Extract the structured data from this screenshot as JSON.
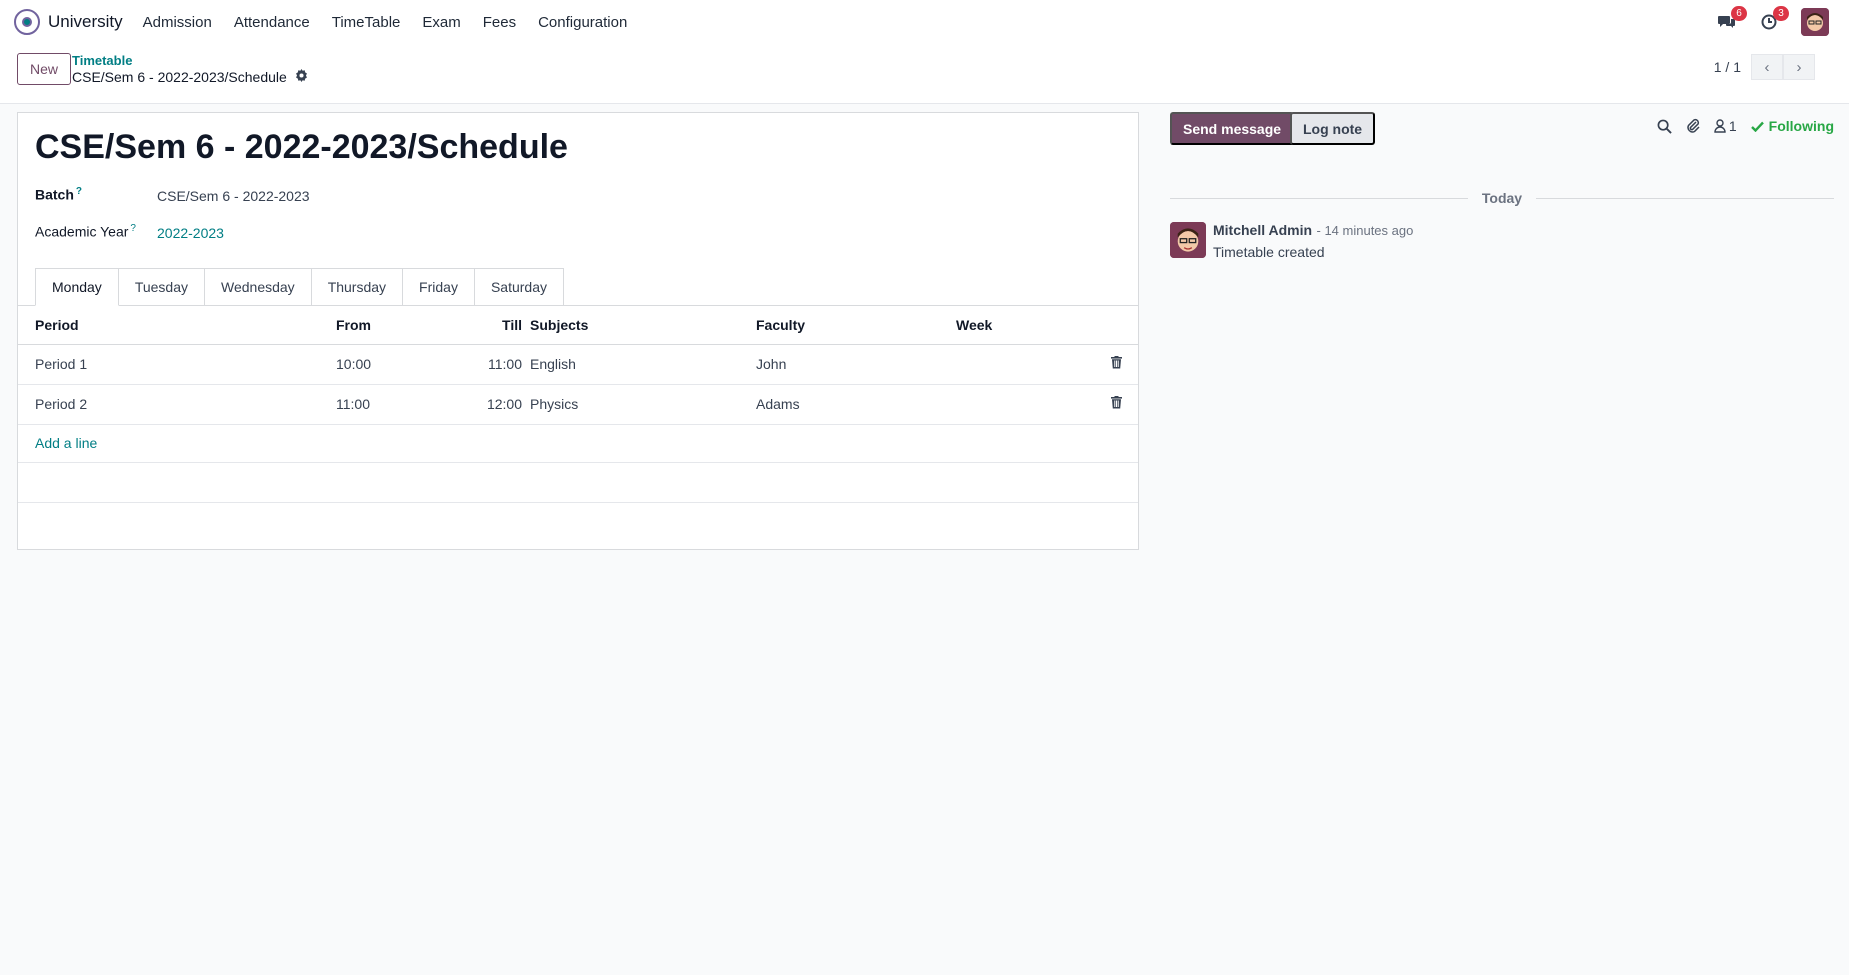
{
  "navbar": {
    "app_name": "University",
    "menu": [
      "Admission",
      "Attendance",
      "TimeTable",
      "Exam",
      "Fees",
      "Configuration"
    ],
    "messages_badge": "6",
    "activity_badge": "3"
  },
  "control_panel": {
    "new_label": "New",
    "breadcrumb_parent": "Timetable",
    "breadcrumb_current": "CSE/Sem 6 - 2022-2023/Schedule",
    "pager_value": "1 / 1"
  },
  "form": {
    "title": "CSE/Sem 6 - 2022-2023/Schedule",
    "batch_label": "Batch",
    "batch_value": "CSE/Sem 6 - 2022-2023",
    "academic_year_label": "Academic Year",
    "academic_year_value": "2022-2023",
    "help_mark": "?",
    "tabs": [
      "Monday",
      "Tuesday",
      "Wednesday",
      "Thursday",
      "Friday",
      "Saturday"
    ],
    "columns": [
      "Period",
      "From",
      "Till",
      "Subjects",
      "Faculty",
      "Week"
    ],
    "rows": [
      {
        "period": "Period 1",
        "from": "10:00",
        "till": "11:00",
        "subject": "English",
        "faculty": "John",
        "week": ""
      },
      {
        "period": "Period 2",
        "from": "11:00",
        "till": "12:00",
        "subject": "Physics",
        "faculty": "Adams",
        "week": ""
      }
    ],
    "add_line_label": "Add a line"
  },
  "chatter": {
    "send_message_label": "Send message",
    "log_note_label": "Log note",
    "followers_count": "1",
    "following_label": "Following",
    "date_separator": "Today",
    "message": {
      "author": "Mitchell Admin",
      "time": "- 14 minutes ago",
      "text": "Timetable created"
    }
  },
  "colors": {
    "brand": "#714b67",
    "link": "#017e84",
    "following": "#28a745",
    "badge": "#dc3545"
  }
}
